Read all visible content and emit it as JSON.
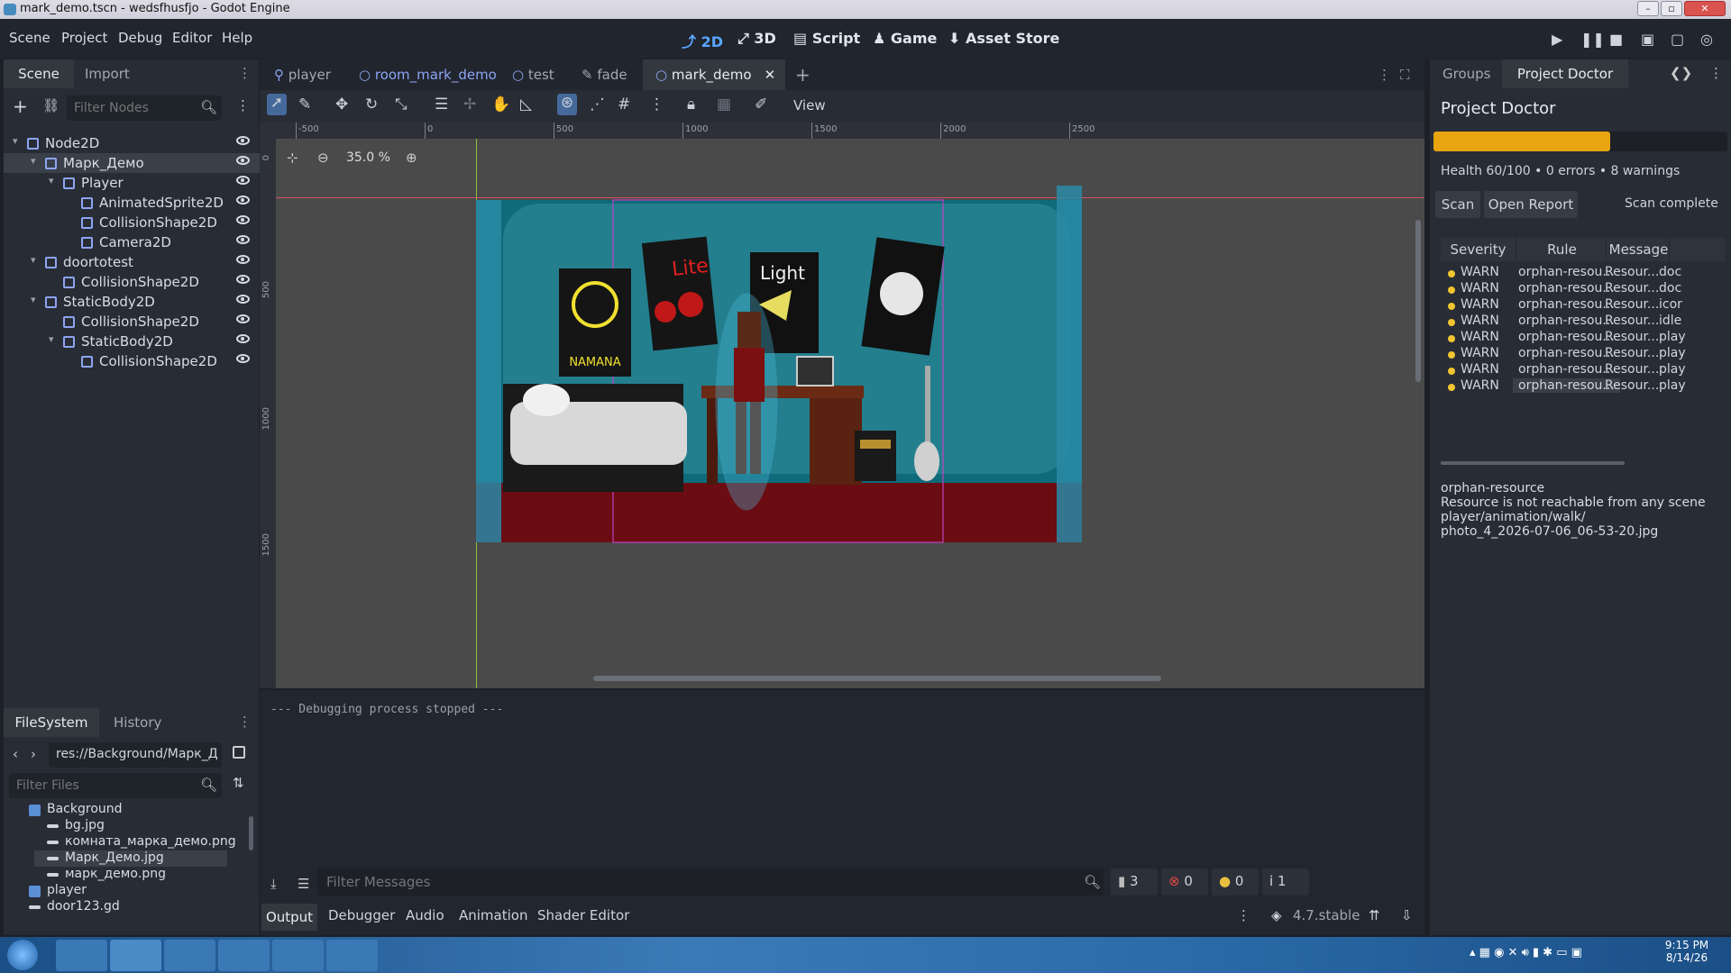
{
  "window": {
    "title": "mark_demo.tscn - wedsfhusfjo - Godot Engine"
  },
  "menus": [
    "Scene",
    "Project",
    "Debug",
    "Editor",
    "Help"
  ],
  "workspaces": [
    {
      "label": "2D",
      "active": true
    },
    {
      "label": "3D"
    },
    {
      "label": "Script"
    },
    {
      "label": "Game"
    },
    {
      "label": "Asset Store"
    }
  ],
  "scene_dock": {
    "tabs": [
      "Scene",
      "Import"
    ],
    "filter_placeholder": "Filter Nodes",
    "nodes": [
      {
        "label": "Node2D",
        "depth": 0,
        "icon": "node2d-icon",
        "color": "#8da5f3"
      },
      {
        "label": "Марк_Демо",
        "depth": 1,
        "icon": "sprite-icon",
        "color": "#8da5f3",
        "selected": true
      },
      {
        "label": "Player",
        "depth": 2,
        "icon": "character-icon",
        "color": "#8da5f3"
      },
      {
        "label": "AnimatedSprite2D",
        "depth": 3,
        "icon": "animated-sprite-icon",
        "color": "#8da5f3"
      },
      {
        "label": "CollisionShape2D",
        "depth": 3,
        "icon": "collision-icon",
        "color": "#8da5f3"
      },
      {
        "label": "Camera2D",
        "depth": 3,
        "icon": "camera-icon",
        "color": "#8da5f3"
      },
      {
        "label": "doortotest",
        "depth": 1,
        "icon": "area-icon",
        "color": "#8da5f3"
      },
      {
        "label": "CollisionShape2D",
        "depth": 2,
        "icon": "collision-icon",
        "color": "#8da5f3"
      },
      {
        "label": "StaticBody2D",
        "depth": 1,
        "icon": "static-body-icon",
        "color": "#8da5f3"
      },
      {
        "label": "CollisionShape2D",
        "depth": 2,
        "icon": "collision-icon",
        "color": "#8da5f3"
      },
      {
        "label": "StaticBody2D",
        "depth": 2,
        "icon": "static-body-icon",
        "color": "#8da5f3"
      },
      {
        "label": "CollisionShape2D",
        "depth": 3,
        "icon": "collision-icon",
        "color": "#8da5f3"
      }
    ]
  },
  "filesystem": {
    "tabs": [
      "FileSystem",
      "History"
    ],
    "path": "res://Background/Марк_Д",
    "filter_placeholder": "Filter Files",
    "items": [
      {
        "label": "Background",
        "type": "folder",
        "depth": 0
      },
      {
        "label": "bg.jpg",
        "type": "file",
        "depth": 1
      },
      {
        "label": "комната_марка_демо.png",
        "type": "file",
        "depth": 1
      },
      {
        "label": "Марк_Демо.jpg",
        "type": "file",
        "depth": 1,
        "selected": true
      },
      {
        "label": "марк_демо.png",
        "type": "file",
        "depth": 1
      },
      {
        "label": "player",
        "type": "folder",
        "depth": 0
      },
      {
        "label": "door123.gd",
        "type": "file",
        "depth": 0
      }
    ]
  },
  "editor_tabs": [
    {
      "label": "player"
    },
    {
      "label": "room_mark_demo"
    },
    {
      "label": "test"
    },
    {
      "label": "fade"
    },
    {
      "label": "mark_demo",
      "active": true
    }
  ],
  "viewport": {
    "zoom": "35.0 %",
    "view_label": "View",
    "ruler_h": [
      "-500",
      "0",
      "500",
      "1000",
      "1500",
      "2000",
      "2500"
    ],
    "ruler_v": [
      "0",
      "500",
      "1000",
      "1500"
    ],
    "poster_texts": [
      "NAMANA",
      "Lite",
      "Light"
    ]
  },
  "output": {
    "log": "--- Debugging process stopped ---",
    "filter_placeholder": "Filter Messages",
    "counts": {
      "messages": "3",
      "errors": "0",
      "warnings": "0",
      "info": "1"
    },
    "tabs": [
      "Output",
      "Debugger",
      "Audio",
      "Animation",
      "Shader Editor"
    ],
    "version": "4.7.stable"
  },
  "right_dock": {
    "tabs": [
      "Groups",
      "Project Doctor"
    ],
    "title": "Project Doctor",
    "health_fraction": 0.6,
    "health_text": "Health 60/100 • 0 errors • 8 warnings",
    "scan_label": "Scan",
    "report_label": "Open Report",
    "status": "Scan complete",
    "columns": [
      "Severity",
      "Rule",
      "Message"
    ],
    "rows": [
      {
        "severity": "WARN",
        "rule": "orphan-resou...",
        "message": "Resour...",
        "extra": "doc"
      },
      {
        "severity": "WARN",
        "rule": "orphan-resou...",
        "message": "Resour...",
        "extra": "doc"
      },
      {
        "severity": "WARN",
        "rule": "orphan-resou...",
        "message": "Resour...",
        "extra": "icor"
      },
      {
        "severity": "WARN",
        "rule": "orphan-resou...",
        "message": "Resour...",
        "extra": "idle"
      },
      {
        "severity": "WARN",
        "rule": "orphan-resou...",
        "message": "Resour...",
        "extra": "play"
      },
      {
        "severity": "WARN",
        "rule": "orphan-resou...",
        "message": "Resour...",
        "extra": "play"
      },
      {
        "severity": "WARN",
        "rule": "orphan-resou...",
        "message": "Resour...",
        "extra": "play"
      },
      {
        "severity": "WARN",
        "rule": "orphan-resou...",
        "message": "Resour...",
        "extra": "play",
        "selected": true
      }
    ],
    "detail": [
      "orphan-resource",
      "Resource is not reachable from any scene",
      "player/animation/walk/",
      "photo_4_2026-07-06_06-53-20.jpg"
    ]
  },
  "taskbar": {
    "time": "9:15 PM",
    "date": "8/14/26"
  }
}
